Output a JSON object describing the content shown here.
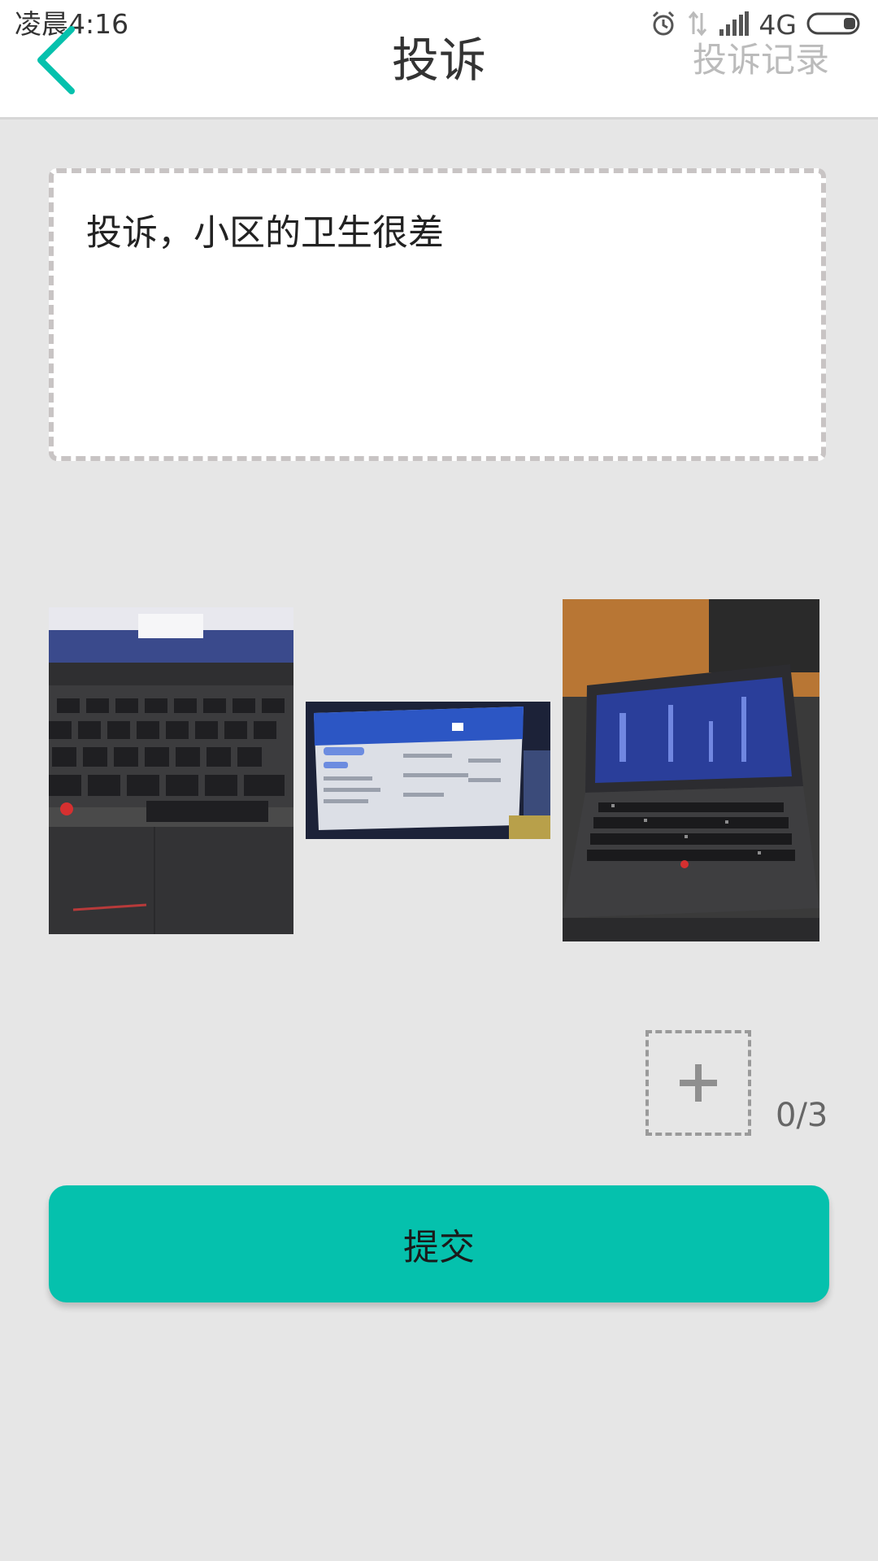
{
  "status_bar": {
    "time": "凌晨4:16",
    "network": "4G",
    "icons": [
      "alarm-icon",
      "data-arrows-icon",
      "signal-icon",
      "battery-icon"
    ]
  },
  "header": {
    "title": "投诉",
    "right_link": "投诉记录",
    "back_icon": "chevron-left-icon"
  },
  "complaint": {
    "text": "投诉，小区的卫生很差"
  },
  "photos": {
    "items": [
      "laptop-keyboard-photo",
      "computer-screen-photo",
      "laptop-photo"
    ],
    "add_icon": "plus-icon",
    "count": "0/3"
  },
  "submit": {
    "label": "提交"
  },
  "colors": {
    "accent": "#05c1ad",
    "background": "#e6e6e6",
    "header_bg": "#ffffff",
    "link_gray": "#bbbbbb"
  }
}
